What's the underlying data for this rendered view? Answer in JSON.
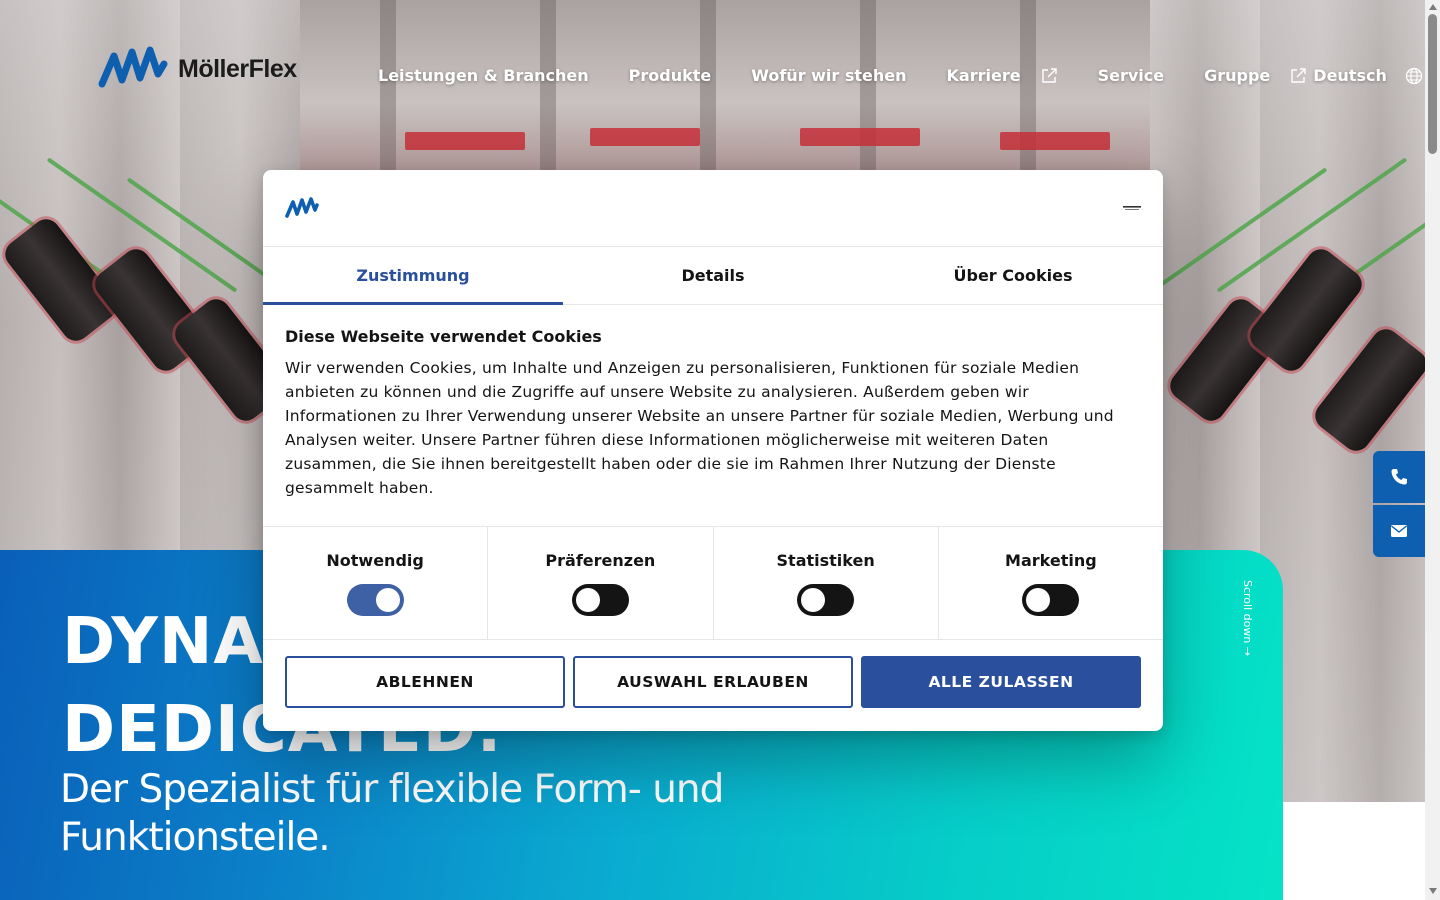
{
  "brand": {
    "name": "MöllerFlex",
    "color": "#0f5fb0"
  },
  "nav": {
    "items": [
      {
        "label": "Leistungen & Branchen"
      },
      {
        "label": "Produkte"
      },
      {
        "label": "Wofür wir stehen"
      },
      {
        "label": "Karriere"
      },
      {
        "label": "Service"
      },
      {
        "label": "Gruppe"
      }
    ],
    "language": "Deutsch"
  },
  "hero": {
    "headline_line1": "DYNAMIC.",
    "headline_line2": "DEDICATED.",
    "subline": "Der Spezialist für flexible Form- und Funktionsteile.",
    "scroll_hint": "Scroll down →",
    "gradient": [
      "#0a5fb8",
      "#05e3c6"
    ]
  },
  "side_buttons": {
    "phone_icon": "phone-icon",
    "mail_icon": "mail-icon"
  },
  "cookie_dialog": {
    "tabs": [
      {
        "label": "Zustimmung",
        "active": true
      },
      {
        "label": "Details",
        "active": false
      },
      {
        "label": "Über Cookies",
        "active": false
      }
    ],
    "title": "Diese Webseite verwendet Cookies",
    "text": "Wir verwenden Cookies, um Inhalte und Anzeigen zu personalisieren, Funktionen für soziale Medien anbieten zu können und die Zugriffe auf unsere Website zu analysieren. Außerdem geben wir Informationen zu Ihrer Verwendung unserer Website an unsere Partner für soziale Medien, Werbung und Analysen weiter. Unsere Partner führen diese Informationen möglicherweise mit weiteren Daten zusammen, die Sie ihnen bereitgestellt haben oder die sie im Rahmen Ihrer Nutzung der Dienste gesammelt haben.",
    "categories": [
      {
        "label": "Notwendig",
        "enabled": true
      },
      {
        "label": "Präferenzen",
        "enabled": false
      },
      {
        "label": "Statistiken",
        "enabled": false
      },
      {
        "label": "Marketing",
        "enabled": false
      }
    ],
    "buttons": {
      "decline": "ABLEHNEN",
      "allow_selection": "AUSWAHL ERLAUBEN",
      "allow_all": "ALLE ZULASSEN"
    },
    "accent": "#2a4f9c"
  }
}
